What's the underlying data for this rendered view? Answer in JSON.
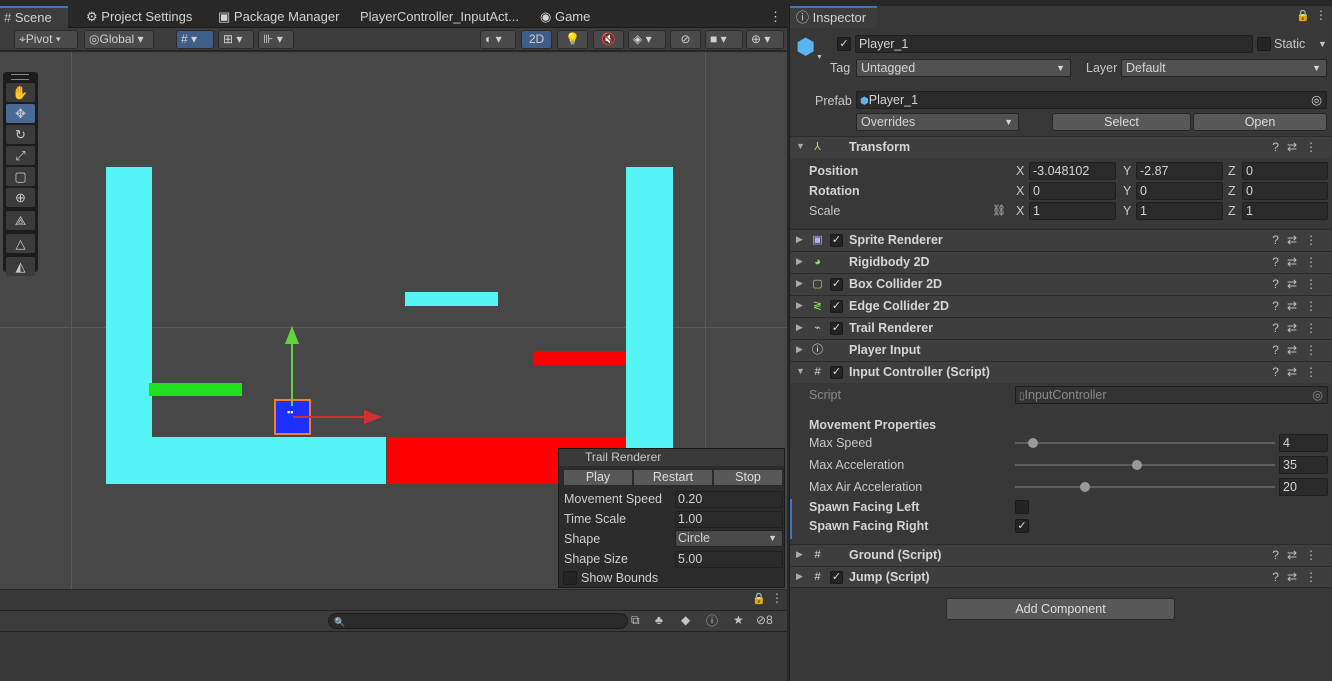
{
  "tabs": {
    "scene": "Scene",
    "project_settings": "Project Settings",
    "package_manager": "Package Manager",
    "input_actions": "PlayerController_InputAct...",
    "game": "Game",
    "inspector": "Inspector"
  },
  "scene_toolbar": {
    "pivot": "Pivot",
    "global": "Global",
    "mode_2d": "2D"
  },
  "trail_overlay": {
    "title": "Trail Renderer",
    "play": "Play",
    "restart": "Restart",
    "stop": "Stop",
    "fields": [
      {
        "label": "Movement Speed",
        "value": "0.20"
      },
      {
        "label": "Time Scale",
        "value": "1.00"
      },
      {
        "label": "Shape",
        "value": "Circle"
      },
      {
        "label": "Shape Size",
        "value": "5.00"
      }
    ],
    "show_bounds": "Show Bounds"
  },
  "console": {
    "count": "8"
  },
  "inspector": {
    "object_name": "Player_1",
    "static_label": "Static",
    "tag_label": "Tag",
    "tag_value": "Untagged",
    "layer_label": "Layer",
    "layer_value": "Default",
    "prefab_label": "Prefab",
    "prefab_value": "Player_1",
    "overrides": "Overrides",
    "select": "Select",
    "open": "Open",
    "transform": {
      "title": "Transform",
      "position_label": "Position",
      "rotation_label": "Rotation",
      "scale_label": "Scale",
      "position": {
        "x": "-3.048102",
        "y": "-2.87",
        "z": "0"
      },
      "rotation": {
        "x": "0",
        "y": "0",
        "z": "0"
      },
      "scale": {
        "x": "1",
        "y": "1",
        "z": "1"
      }
    },
    "components": [
      "Sprite Renderer",
      "Rigidbody 2D",
      "Box Collider 2D",
      "Edge Collider 2D",
      "Trail Renderer",
      "Player Input",
      "Input Controller (Script)"
    ],
    "input_controller": {
      "script_label": "Script",
      "script_value": "InputController",
      "section": "Movement Properties",
      "max_speed_label": "Max Speed",
      "max_speed": "4",
      "max_speed_fraction": 0.07,
      "max_accel_label": "Max Acceleration",
      "max_accel": "35",
      "max_accel_fraction": 0.47,
      "max_air_label": "Max Air Acceleration",
      "max_air": "20",
      "max_air_fraction": 0.27,
      "spawn_left_label": "Spawn Facing Left",
      "spawn_right_label": "Spawn Facing Right"
    },
    "ground": "Ground (Script)",
    "jump": "Jump (Script)",
    "add_component": "Add Component"
  },
  "colors": {
    "cyan": "#55f5f5",
    "red": "#ff0000",
    "green": "#20e020",
    "player_blue": "#1f2fff",
    "accent": "#3a79bb"
  }
}
